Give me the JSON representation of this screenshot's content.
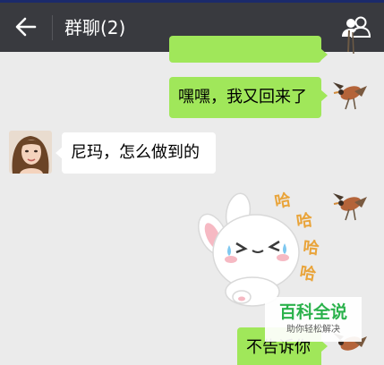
{
  "header": {
    "title": "群聊(2)",
    "back_icon": "arrow-left-icon",
    "members_icon": "group-members-icon"
  },
  "messages": [
    {
      "side": "right",
      "type": "text",
      "text": "",
      "truncated": true
    },
    {
      "side": "right",
      "type": "text",
      "text": "嘿嘿，我又回来了"
    },
    {
      "side": "left",
      "type": "text",
      "text": "尼玛，怎么做到的"
    },
    {
      "side": "right",
      "type": "sticker",
      "sticker_text": "哈哈哈哈"
    },
    {
      "side": "right",
      "type": "text",
      "text": "不告诉你"
    }
  ],
  "watermark": {
    "main": "百科全说",
    "sub": "助你轻松解决"
  },
  "colors": {
    "header_bg": "#393a3f",
    "chat_bg": "#ebebeb",
    "bubble_self": "#a0e75a",
    "bubble_other": "#ffffff",
    "watermark_green": "#2bb24c"
  }
}
